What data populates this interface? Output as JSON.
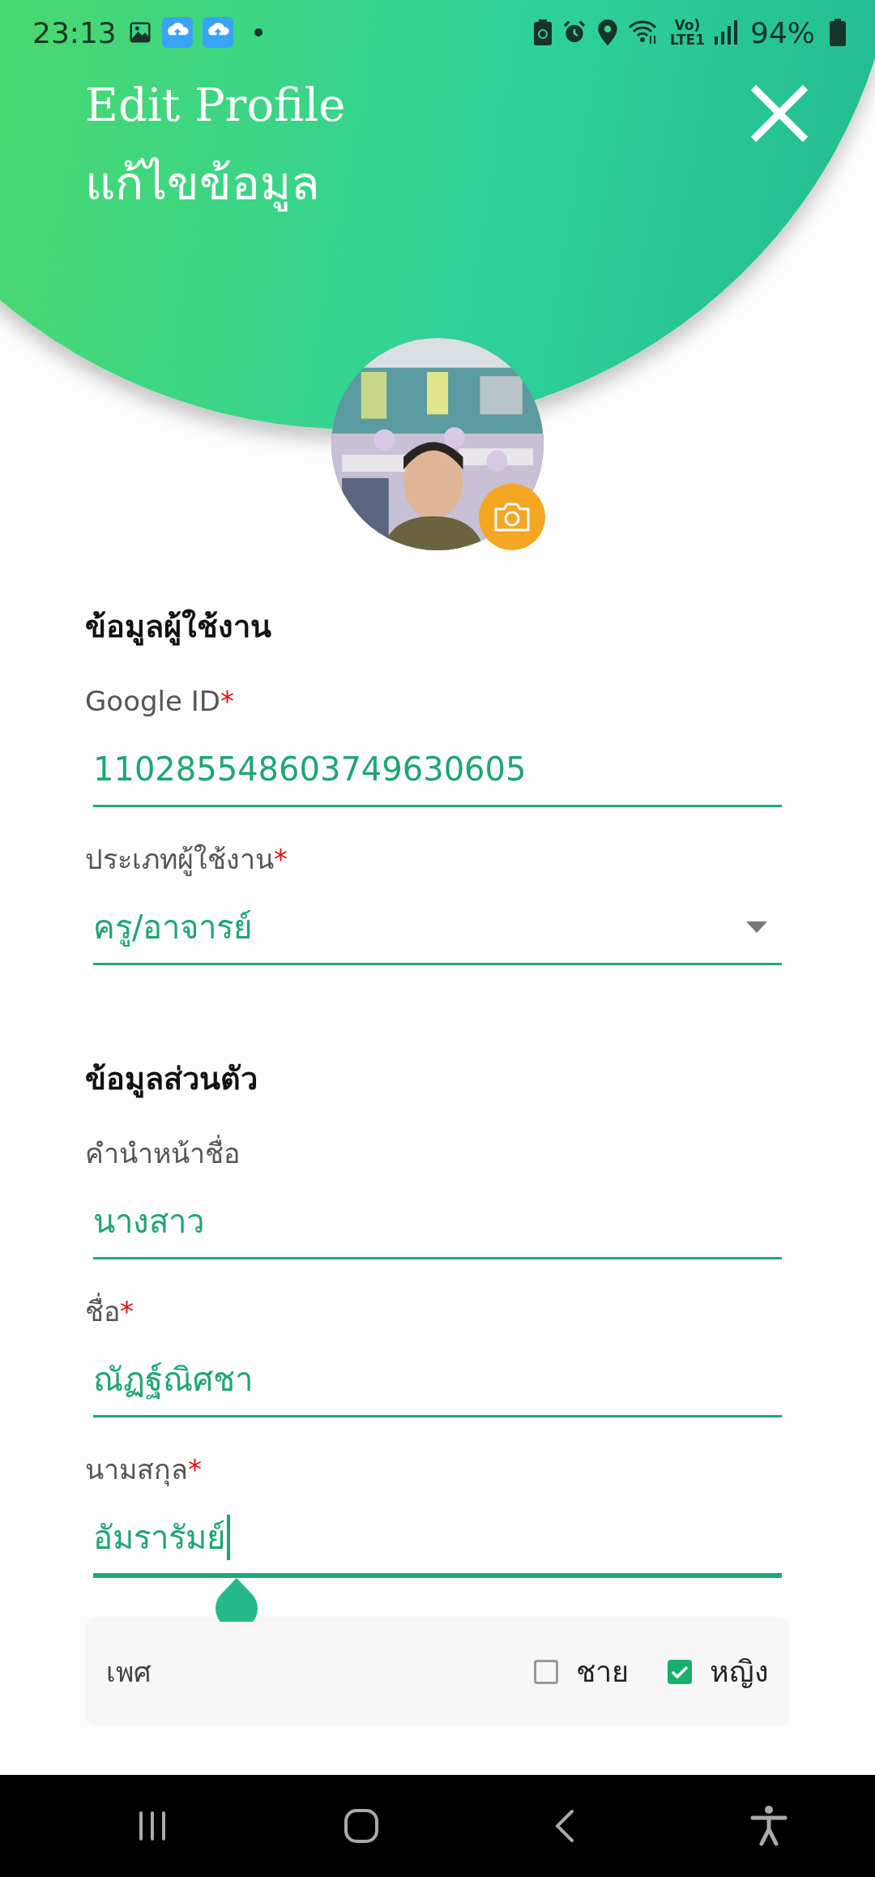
{
  "status_bar": {
    "time": "23:13",
    "volte": "Vo)",
    "network": "LTE1",
    "battery": "94%"
  },
  "header": {
    "title": "Edit Profile",
    "subtitle": "แก้ไขข้อมูล"
  },
  "sections": [
    {
      "title": "ข้อมูลผู้ใช้งาน",
      "fields": [
        {
          "kind": "text",
          "label": "Google ID",
          "required_mark": "*",
          "value": "110285548603749630605",
          "focused": false
        },
        {
          "kind": "dropdown",
          "label": "ประเภทผู้ใช้งาน",
          "required_mark": "*",
          "value": "ครู/อาจารย์",
          "focused": false
        }
      ]
    },
    {
      "title": "ข้อมูลส่วนตัว",
      "fields": [
        {
          "kind": "text",
          "label": "คำนำหน้าชื่อ",
          "value": "นางสาว",
          "focused": false
        },
        {
          "kind": "text",
          "label": "ชื่อ",
          "required_mark": "*",
          "value": "ณัฏฐ์ณิศชา",
          "focused": false
        },
        {
          "kind": "text",
          "label": "นามสกุล",
          "required_mark": "*",
          "value": "อัมรารัมย์",
          "focused": true
        }
      ]
    }
  ],
  "gender": {
    "label": "เพศ",
    "options": [
      {
        "label": "ชาย",
        "checked": false
      },
      {
        "label": "หญิง",
        "checked": true
      }
    ]
  }
}
